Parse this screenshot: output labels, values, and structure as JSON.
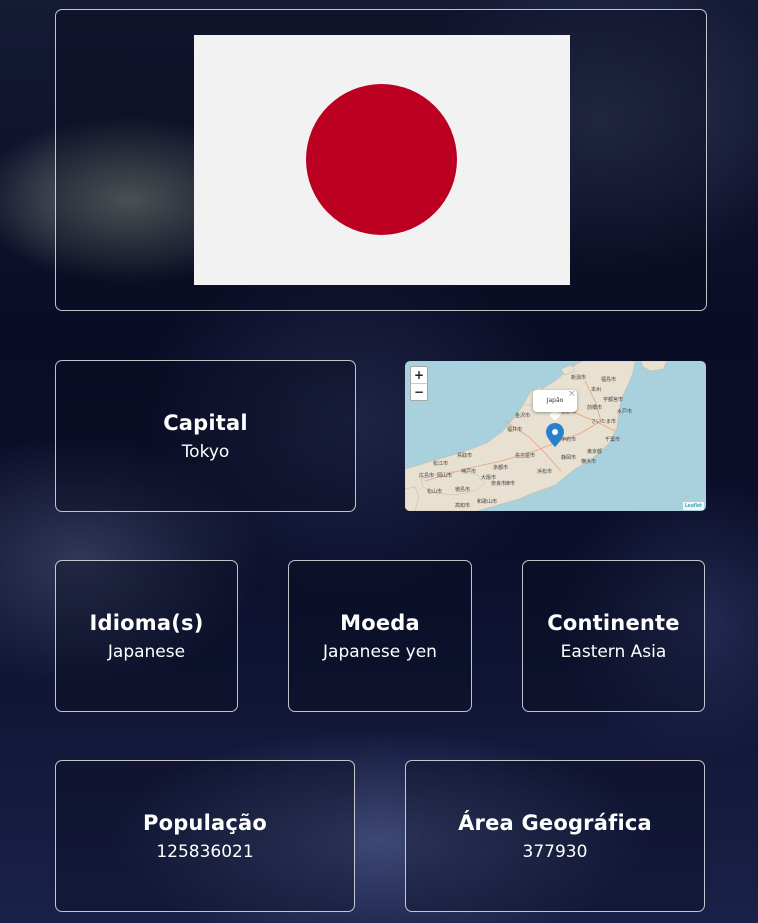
{
  "flag": {
    "background_color": "#f2f2f2",
    "disc_color": "#bc0022"
  },
  "capital": {
    "title": "Capital",
    "value": "Tokyo"
  },
  "map": {
    "zoom_in_label": "+",
    "zoom_out_label": "−",
    "popup_label": "Japão",
    "popup_close": "×",
    "attribution": "Leaflet",
    "marker_color": "#2a81cb",
    "water_color": "#a9d0dd",
    "land_color": "#e8e0d0",
    "place_labels": [
      "本州",
      "福井市",
      "金沢市",
      "長野市",
      "前橋市",
      "宇都宮市",
      "水戸市",
      "さいたま市",
      "東京都",
      "名古屋市",
      "京都市",
      "大阪市",
      "神戸市",
      "岡山市",
      "広島市",
      "松山市",
      "高知市",
      "徳島市",
      "和歌山市",
      "甲府市",
      "静岡市",
      "浜松市",
      "津市",
      "奈良市",
      "新潟市",
      "千葉市",
      "横浜市",
      "鳥取市",
      "松江市",
      "福島市"
    ]
  },
  "language": {
    "title": "Idioma(s)",
    "value": "Japanese"
  },
  "currency": {
    "title": "Moeda",
    "value": "Japanese yen"
  },
  "continent": {
    "title": "Continente",
    "value": "Eastern Asia"
  },
  "population": {
    "title": "População",
    "value": "125836021"
  },
  "area": {
    "title": "Área Geográfica",
    "value": "377930"
  }
}
